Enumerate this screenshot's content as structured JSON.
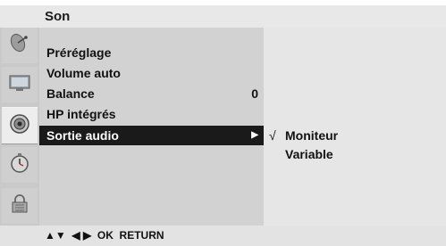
{
  "header": {
    "title": "Son"
  },
  "sidebar": {
    "icons": [
      {
        "name": "satellite-dish-icon",
        "active": false
      },
      {
        "name": "picture-monitor-icon",
        "active": false
      },
      {
        "name": "speaker-icon",
        "active": true
      },
      {
        "name": "clock-icon",
        "active": false
      },
      {
        "name": "lock-icon",
        "active": false
      }
    ]
  },
  "menu": {
    "items": [
      {
        "label": "Préréglage",
        "value": ""
      },
      {
        "label": "Volume auto",
        "value": ""
      },
      {
        "label": "Balance",
        "value": "0"
      },
      {
        "label": "HP intégrés",
        "value": ""
      },
      {
        "label": "Sortie audio",
        "value": ""
      }
    ],
    "selected_index": 4,
    "submenu_arrow": "▶"
  },
  "submenu": {
    "check_mark": "√",
    "options": [
      {
        "label": "Moniteur",
        "checked": true
      },
      {
        "label": "Variable",
        "checked": false
      }
    ]
  },
  "footer": {
    "hint": "▲▼  ◀ ▶  OK  RETURN"
  },
  "colors": {
    "selection_bg": "#1a1a1a",
    "panel_left": "#d2d2d2",
    "panel_right": "#e6e6e6",
    "title_bar": "#e8e8e8"
  }
}
